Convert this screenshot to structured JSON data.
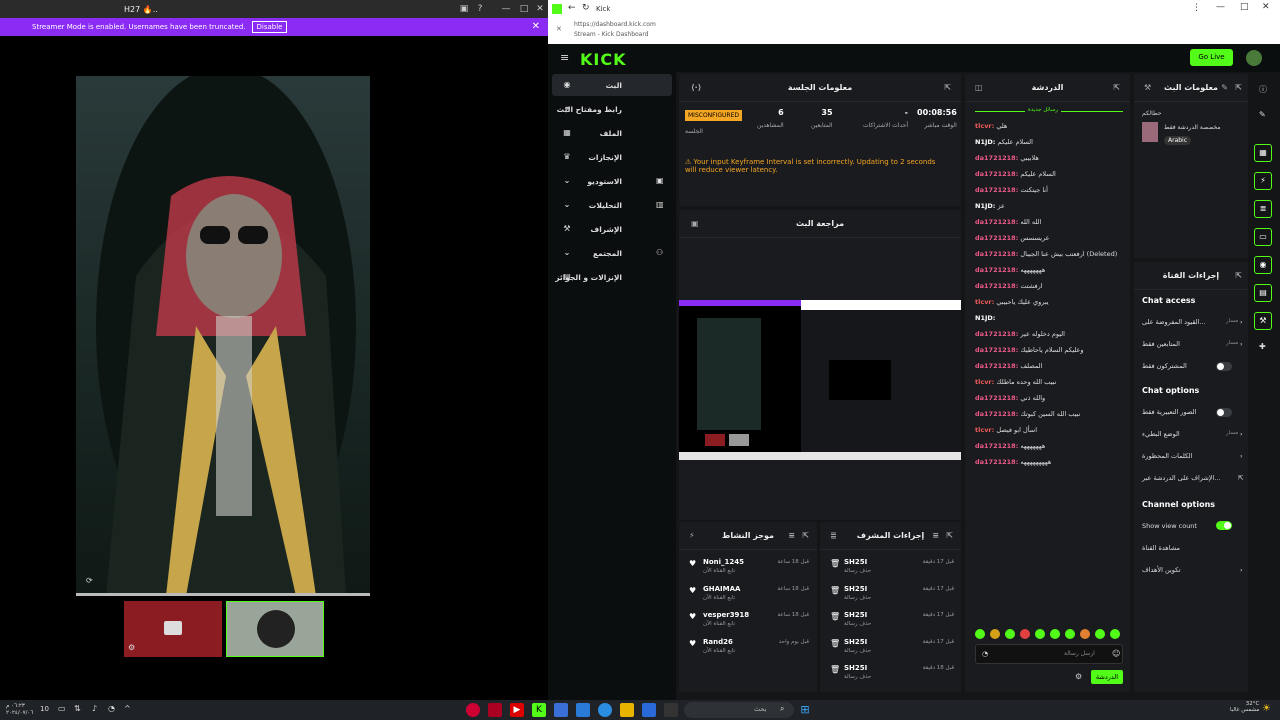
{
  "left_window": {
    "title": "H27 🔥..",
    "streamer_mode_text": "Streamer Mode is enabled. Usernames have been truncated.",
    "disable_label": "Disable"
  },
  "browser": {
    "tab_title": "Kick",
    "url": "https://dashboard.kick.com",
    "subtitle": "Stream - Kick Dashboard"
  },
  "kick": {
    "logo": "KICK",
    "go_live_label": "Go Live"
  },
  "sidebar": {
    "items": [
      {
        "label": "البث",
        "icon": "broadcast-icon"
      },
      {
        "label": "رابط ومفتاح البث",
        "icon": "link-icon"
      },
      {
        "label": "الملف",
        "icon": "profile-icon"
      },
      {
        "label": "الإنجازات",
        "icon": "trophy-icon"
      },
      {
        "label": "الاستوديو",
        "icon": "studio-icon"
      },
      {
        "label": "التحليلات",
        "icon": "analytics-icon"
      },
      {
        "label": "الإشراف",
        "icon": "moderation-icon"
      },
      {
        "label": "المجتمع",
        "icon": "community-icon"
      },
      {
        "label": "الإنزالات و الجوائز",
        "icon": "drops-icon"
      }
    ]
  },
  "session": {
    "title": "معلومات الجلسة",
    "badge": "MISCONFIGURED",
    "badge_sub": "الجلسة",
    "viewers_value": "6",
    "viewers_label": "المشاهدين",
    "followers_value": "35",
    "followers_label": "المتابعين",
    "subs_value": "-",
    "subs_label": "أحداث الاشتراكات",
    "time_value": "00:08:56",
    "time_label": "الوقت مباشر",
    "warning": "Your input Keyframe Interval is set incorrectly. Updating to 2 seconds will reduce viewer latency."
  },
  "preview": {
    "title": "مراجعة البث"
  },
  "chat": {
    "title": "الدردشة",
    "new_messages": "رسائل جديدة",
    "messages": [
      {
        "user": "tlcvr:",
        "text": "هلي"
      },
      {
        "user": "N1JD:",
        "text": "السلام عليكم"
      },
      {
        "user": "da1721218:",
        "text": "هلابيبي"
      },
      {
        "user": "da1721218:",
        "text": "السلام عليكم"
      },
      {
        "user": "da1721218:",
        "text": "أنا جيتكتت"
      },
      {
        "user": "N1JD:",
        "text": "عز"
      },
      {
        "user": "da1721218:",
        "text": "الله الله"
      },
      {
        "user": "da1721218:",
        "text": "عريسسس"
      },
      {
        "user": "da1721218:",
        "text": "ارفعتب بيش عنا الجيبال (Deleted)"
      },
      {
        "user": "da1721218:",
        "text": "هههههههه"
      },
      {
        "user": "da1721218:",
        "text": "ارفشتت"
      },
      {
        "user": "tlcvr:",
        "text": "يبروي عليك ياحبيبي"
      },
      {
        "user": "N1JD:",
        "text": ""
      },
      {
        "user": "da1721218:",
        "text": "اليوم دخلوله عير"
      },
      {
        "user": "da1721218:",
        "text": "وعليكم السلام ياحاطيك"
      },
      {
        "user": "da1721218:",
        "text": "المصلف"
      },
      {
        "user": "tlcvr:",
        "text": "نبيب الله وحده ماطلك"
      },
      {
        "user": "da1721218:",
        "text": "والله ذني"
      },
      {
        "user": "da1721218:",
        "text": "نبيب الله السين كبوتك"
      },
      {
        "user": "tlcvr:",
        "text": "اسأل ابو فيصل"
      },
      {
        "user": "da1721218:",
        "text": "هههههههه"
      },
      {
        "user": "da1721218:",
        "text": "هههههههههه"
      }
    ],
    "input_placeholder": "ارسل رسالة",
    "send_label": "الدردشة"
  },
  "stream_info": {
    "title": "معلومات البث",
    "category": "مخصصة الدردشة فقط",
    "name": "حطالكم",
    "language": "Arabic"
  },
  "channel_actions": {
    "title": "إجراءات القناة",
    "chat_access_heading": "Chat access",
    "chat_access_rows": [
      {
        "label": "القيود المفروضة على...",
        "value": "مسار"
      },
      {
        "label": "المتابعين فقط",
        "value": "مسار"
      },
      {
        "label": "المشتركون فقط",
        "value": ""
      }
    ],
    "chat_options_heading": "Chat options",
    "chat_options_rows": [
      {
        "label": "الصور التعبيرية فقط",
        "value": ""
      },
      {
        "label": "الوضع البطيء",
        "value": "مسار"
      },
      {
        "label": "الكلمات المحظورة",
        "value": ""
      },
      {
        "label": "الإشراف على الدردشة عبر...",
        "value": ""
      }
    ],
    "channel_options_heading": "Channel options",
    "channel_options_rows": [
      {
        "label": "Show view count",
        "value": ""
      },
      {
        "label": "مشاهدة القناة",
        "value": ""
      },
      {
        "label": "تكوين الأهداف",
        "value": ""
      }
    ]
  },
  "activity": {
    "title": "موجز النشاط",
    "items": [
      {
        "name": "Noni_1245",
        "sub": "تابع القناة الآن",
        "time": "قبل 18 ساعة"
      },
      {
        "name": "GHAIMAA",
        "sub": "تابع القناة الآن",
        "time": "قبل 18 ساعة"
      },
      {
        "name": "vesper3918",
        "sub": "تابع القناة الآن",
        "time": "قبل 18 ساعة"
      },
      {
        "name": "Rand26",
        "sub": "تابع القناة الآن",
        "time": "قبل يوم واحد"
      }
    ]
  },
  "mod_actions": {
    "title": "إجراءات المشرف",
    "items": [
      {
        "name": "SH25I",
        "sub": "حذف رسالة",
        "time": "قبل 17 دقيقة"
      },
      {
        "name": "SH25I",
        "sub": "حذف رسالة",
        "time": "قبل 17 دقيقة"
      },
      {
        "name": "SH25I",
        "sub": "حذف رسالة",
        "time": "قبل 17 دقيقة"
      },
      {
        "name": "SH25I",
        "sub": "حذف رسالة",
        "time": "قبل 17 دقيقة"
      },
      {
        "name": "SH25I",
        "sub": "حذف رسالة",
        "time": "قبل 18 دقيقة"
      }
    ]
  },
  "taskbar": {
    "search_placeholder": "بحث",
    "weather_temp": "32°C",
    "weather_text": "مشمس غالبا",
    "left_time": "٠٦:٢٣ م",
    "left_date": "٢٠٢٤/٠٧/٠٦",
    "left_num": "10"
  }
}
